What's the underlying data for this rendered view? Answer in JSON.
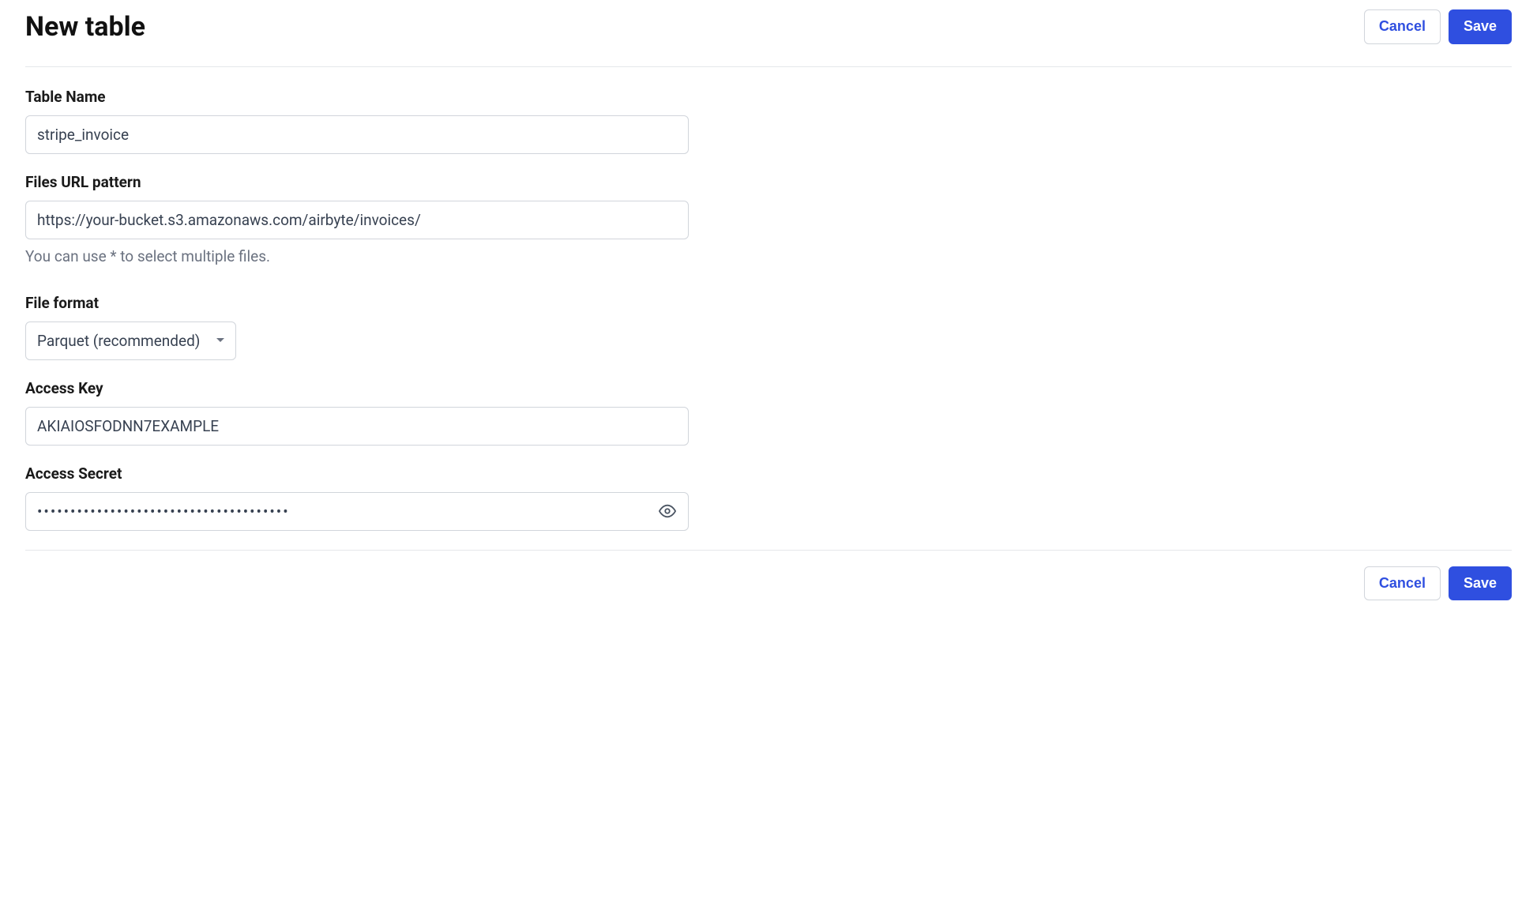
{
  "header": {
    "title": "New table",
    "cancel_label": "Cancel",
    "save_label": "Save"
  },
  "form": {
    "table_name": {
      "label": "Table Name",
      "value": "stripe_invoice"
    },
    "files_url": {
      "label": "Files URL pattern",
      "value": "https://your-bucket.s3.amazonaws.com/airbyte/invoices/",
      "help": "You can use * to select multiple files."
    },
    "file_format": {
      "label": "File format",
      "value": "Parquet (recommended)"
    },
    "access_key": {
      "label": "Access Key",
      "value": "AKIAIOSFODNN7EXAMPLE"
    },
    "access_secret": {
      "label": "Access Secret",
      "value": "••••••••••••••••••••••••••••••••••••••"
    }
  },
  "footer": {
    "cancel_label": "Cancel",
    "save_label": "Save"
  }
}
